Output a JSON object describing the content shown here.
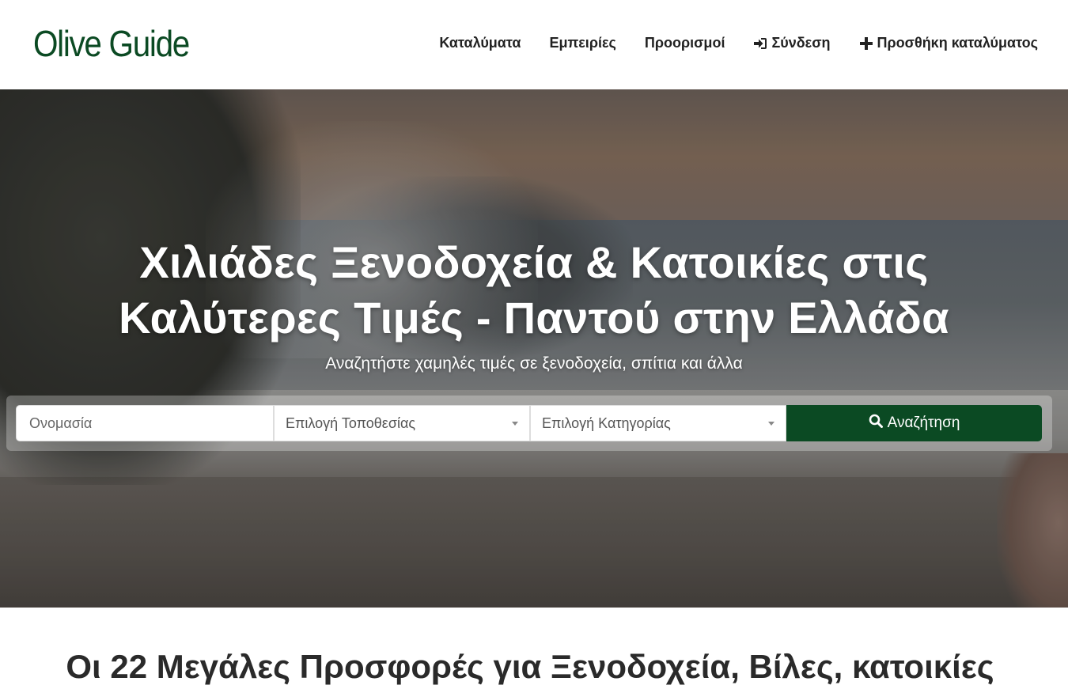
{
  "header": {
    "logo": "Olive Guide",
    "nav": [
      {
        "label": "Καταλύματα",
        "icon": ""
      },
      {
        "label": "Εμπειρίες",
        "icon": ""
      },
      {
        "label": "Προορισμοί",
        "icon": ""
      },
      {
        "label": "Σύνδεση",
        "icon": "sign-in-icon"
      },
      {
        "label": "Προσθήκη καταλύματος",
        "icon": "plus-icon"
      }
    ]
  },
  "hero": {
    "title_line1": "Χιλιάδες Ξενοδοχεία & Κατοικίες στις",
    "title_line2": "Καλύτερες Τιμές - Παντού στην Ελλάδα",
    "subtitle": "Αναζητήστε χαμηλές τιμές σε ξενοδοχεία, σπίτια και άλλα"
  },
  "search": {
    "name_placeholder": "Ονομασία",
    "location_value": "Επιλογή Τοποθεσίας",
    "category_value": "Επιλογή Κατηγορίας",
    "button_label": "Αναζήτηση",
    "button_icon": "search-icon",
    "button_color": "#0b4a23"
  },
  "offers": {
    "title": "Οι 22 Μεγάλες Προσφορές για Ξενοδοχεία, Βίλες, κατοικίες"
  },
  "colors": {
    "brand": "#0b4a23"
  }
}
